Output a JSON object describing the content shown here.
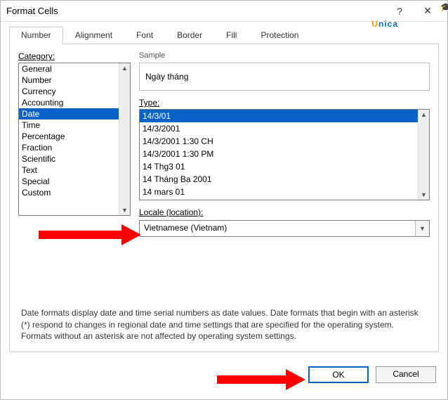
{
  "window": {
    "title": "Format Cells"
  },
  "logo": {
    "u": "U",
    "rest": "nica"
  },
  "tabs": {
    "number": "Number",
    "alignment": "Alignment",
    "font": "Font",
    "border": "Border",
    "fill": "Fill",
    "protection": "Protection"
  },
  "number_tab": {
    "category_label": "Category:",
    "categories": [
      "General",
      "Number",
      "Currency",
      "Accounting",
      "Date",
      "Time",
      "Percentage",
      "Fraction",
      "Scientific",
      "Text",
      "Special",
      "Custom"
    ],
    "selected_category_index": 4,
    "sample_label": "Sample",
    "sample_value": "Ngày tháng",
    "type_label": "Type:",
    "types": [
      "14/3/01",
      "14/3/2001",
      "14/3/2001 1:30 CH",
      "14/3/2001 1:30 PM",
      "14 Thg3 01",
      "14 Tháng Ba 2001",
      "14 mars 01"
    ],
    "selected_type_index": 0,
    "locale_label": "Locale (location):",
    "locale_value": "Vietnamese (Vietnam)",
    "description": "Date formats display date and time serial numbers as date values.  Date formats that begin with an asterisk (*) respond to changes in regional date and time settings that are specified for the operating system. Formats without an asterisk are not affected by operating system settings."
  },
  "buttons": {
    "ok": "OK",
    "cancel": "Cancel"
  }
}
